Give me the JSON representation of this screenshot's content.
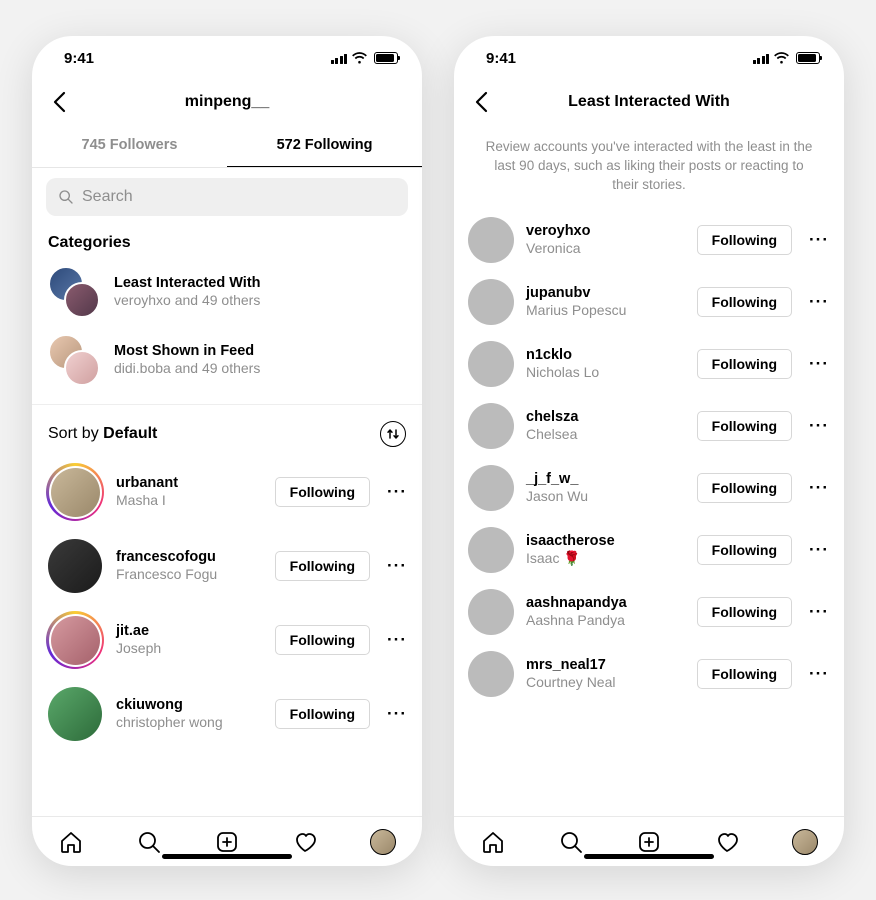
{
  "status": {
    "time": "9:41"
  },
  "left": {
    "title": "minpeng__",
    "tabs": {
      "followers": "745 Followers",
      "following": "572 Following",
      "active": "following"
    },
    "search_placeholder": "Search",
    "categories_heading": "Categories",
    "categories": [
      {
        "title": "Least Interacted With",
        "sub": "veroyhxo and 49 others"
      },
      {
        "title": "Most Shown in Feed",
        "sub": "didi.boba and 49 others"
      }
    ],
    "sort_prefix": "Sort by ",
    "sort_value": "Default",
    "follow_label": "Following",
    "accounts": [
      {
        "username": "urbanant",
        "name": "Masha I",
        "story": true,
        "bg": "av-bg-9"
      },
      {
        "username": "francescofogu",
        "name": "Francesco Fogu",
        "story": false,
        "bg": "av-bg-10"
      },
      {
        "username": "jit.ae",
        "name": "Joseph",
        "story": true,
        "bg": "av-bg-11"
      },
      {
        "username": "ckiuwong",
        "name": "christopher wong",
        "story": false,
        "bg": "av-bg-12"
      }
    ]
  },
  "right": {
    "title": "Least Interacted With",
    "description": "Review accounts you've interacted with the least in the last 90 days, such as liking their posts or reacting to their stories.",
    "follow_label": "Following",
    "accounts": [
      {
        "username": "veroyhxo",
        "name": "Veronica",
        "bg": "av-bg-1"
      },
      {
        "username": "jupanubv",
        "name": "Marius Popescu",
        "bg": "av-bg-2"
      },
      {
        "username": "n1cklo",
        "name": "Nicholas Lo",
        "bg": "av-bg-3"
      },
      {
        "username": "chelsza",
        "name": "Chelsea",
        "bg": "av-bg-4"
      },
      {
        "username": "_j_f_w_",
        "name": "Jason Wu",
        "bg": "av-bg-5"
      },
      {
        "username": "isaactherose",
        "name": "Isaac 🌹",
        "bg": "av-bg-6"
      },
      {
        "username": "aashnapandya",
        "name": "Aashna Pandya",
        "bg": "av-bg-7"
      },
      {
        "username": "mrs_neal17",
        "name": "Courtney Neal",
        "bg": "av-bg-8"
      }
    ]
  }
}
